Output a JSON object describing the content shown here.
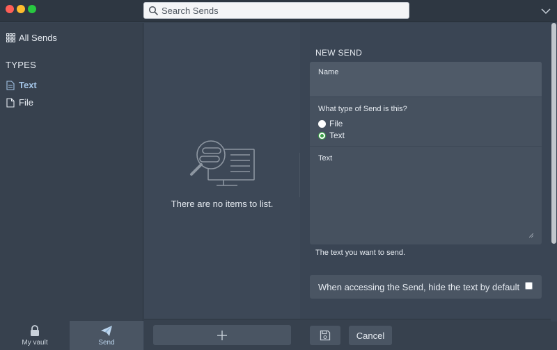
{
  "titlebar": {
    "search_placeholder": "Search Sends",
    "search_value": ""
  },
  "sidebar": {
    "all_label": "All Sends",
    "types_heading": "TYPES",
    "items": [
      {
        "label": "Text",
        "active": true,
        "icon": "text-doc-icon"
      },
      {
        "label": "File",
        "active": false,
        "icon": "file-icon"
      }
    ]
  },
  "bottom_nav": [
    {
      "label": "My vault",
      "icon": "lock-icon",
      "active": false
    },
    {
      "label": "Send",
      "icon": "paper-plane-icon",
      "active": true
    }
  ],
  "list": {
    "empty_message": "There are no items to list.",
    "add_icon": "plus-icon"
  },
  "form": {
    "heading": "NEW SEND",
    "name_label": "Name",
    "name_value": "",
    "type_question": "What type of Send is this?",
    "type_options": [
      {
        "label": "File",
        "checked": false
      },
      {
        "label": "Text",
        "checked": true
      }
    ],
    "text_label": "Text",
    "text_value": "",
    "text_help": "The text you want to send.",
    "hide_option_label": "When accessing the Send, hide the text by default",
    "hide_option_checked": false,
    "save_icon": "floppy-disk-icon",
    "cancel_label": "Cancel"
  },
  "colors": {
    "accent_green": "#3b9f46",
    "active_blue": "#a3c4e6"
  }
}
